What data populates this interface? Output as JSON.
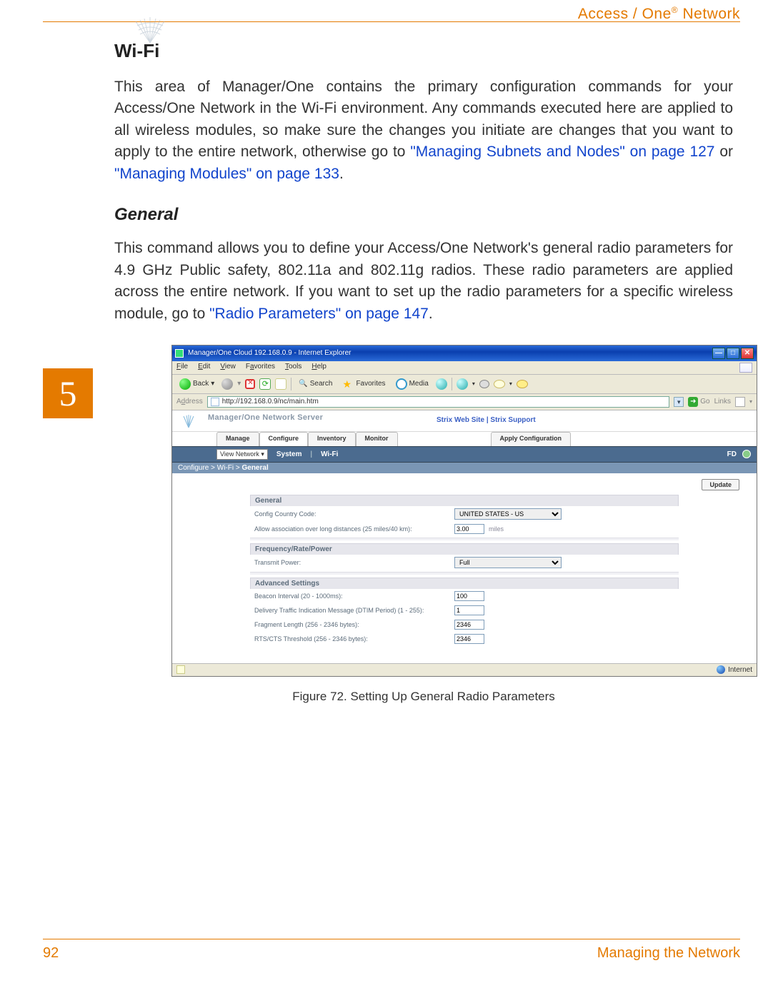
{
  "header": {
    "product": "Access / One",
    "reg": "®",
    "suffix": " Network"
  },
  "chapter_tab": "5",
  "section_title": "Wi-Fi",
  "para1_pre": "This area of Manager/One contains the primary configuration commands for your Access/One Network in the Wi-Fi environment. Any commands executed here are applied to all wireless modules, so make sure the changes you initiate are changes that you want to apply to the entire network, otherwise go to ",
  "link1": "\"Managing Subnets and Nodes\" on page 127",
  "para1_mid": " or ",
  "link2": "\"Managing Modules\" on page 133",
  "para1_post": ".",
  "subhead": "General",
  "para2_pre": "This command allows you to define your Access/One Network's general radio parameters for 4.9 GHz Public safety, 802.11a and 802.11g radios. These radio parameters are applied across the entire network. If you want to set up the radio parameters for a specific wireless module, go to ",
  "link3": "\"Radio Parameters\" on page 147",
  "para2_post": ".",
  "screenshot": {
    "title": "Manager/One Cloud 192.168.0.9 - Internet Explorer",
    "menus": [
      "File",
      "Edit",
      "View",
      "Favorites",
      "Tools",
      "Help"
    ],
    "toolbar": {
      "back": "Back",
      "search": "Search",
      "favorites": "Favorites",
      "media": "Media"
    },
    "address_label": "Address",
    "url": "http://192.168.0.9/nc/main.htm",
    "go": "Go",
    "links": "Links",
    "strix_label": "Manager/One Network Server",
    "strix_links": "Strix Web Site  |  Strix Support",
    "tabs": [
      "Manage",
      "Configure",
      "Inventory",
      "Monitor"
    ],
    "apply_tab": "Apply Configuration",
    "subtab_dd": "View Network",
    "subtab_items": [
      "System",
      "Wi-Fi"
    ],
    "subtab_right": "FD",
    "breadcrumb_pre": "Configure > Wi-Fi > ",
    "breadcrumb_cur": "General",
    "update_btn": "Update",
    "groups": {
      "g1": "General",
      "country_lbl": "Config Country Code:",
      "country_val": "UNITED STATES - US",
      "assoc_lbl": "Allow association over long distances (25 miles/40 km):",
      "assoc_val": "3.00",
      "assoc_unit": "miles",
      "g2": "Frequency/Rate/Power",
      "tx_lbl": "Transmit Power:",
      "tx_val": "Full",
      "g3": "Advanced Settings",
      "beacon_lbl": "Beacon Interval (20 - 1000ms):",
      "beacon_val": "100",
      "dtim_lbl": "Delivery Traffic Indication Message (DTIM Period) (1 - 255):",
      "dtim_val": "1",
      "frag_lbl": "Fragment Length (256 - 2346 bytes):",
      "frag_val": "2346",
      "rts_lbl": "RTS/CTS Threshold (256 - 2346 bytes):",
      "rts_val": "2346"
    },
    "status_zone": "Internet"
  },
  "figure_caption": "Figure 72. Setting Up General Radio Parameters",
  "footer": {
    "page": "92",
    "chapter": "Managing the Network"
  }
}
